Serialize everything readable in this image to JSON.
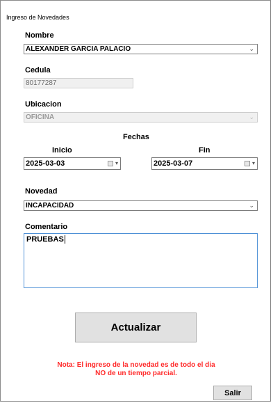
{
  "window": {
    "title": "Ingreso de Novedades"
  },
  "form": {
    "nombre": {
      "label": "Nombre",
      "value": "ALEXANDER GARCIA PALACIO"
    },
    "cedula": {
      "label": "Cedula",
      "value": "80177287"
    },
    "ubicacion": {
      "label": "Ubicacion",
      "value": "OFICINA"
    },
    "fechas": {
      "label": "Fechas",
      "inicio": {
        "label": "Inicio",
        "value": "2025-03-03"
      },
      "fin": {
        "label": "Fin",
        "value": "2025-03-07"
      }
    },
    "novedad": {
      "label": "Novedad",
      "value": "INCAPACIDAD"
    },
    "comentario": {
      "label": "Comentario",
      "value": "PRUEBAS"
    }
  },
  "actions": {
    "actualizar_label": "Actualizar",
    "salir_label": "Salir"
  },
  "note": {
    "line1": "Nota: El ingreso de la novedad es de todo el dia",
    "line2": "NO de un tiempo parcial."
  },
  "icons": {
    "dropdown": "chevron-down-icon",
    "calendar": "calendar-icon"
  },
  "colors": {
    "note_text": "#ff2a2a",
    "focus_border": "#4d90d6",
    "button_bg": "#e1e1e1"
  }
}
